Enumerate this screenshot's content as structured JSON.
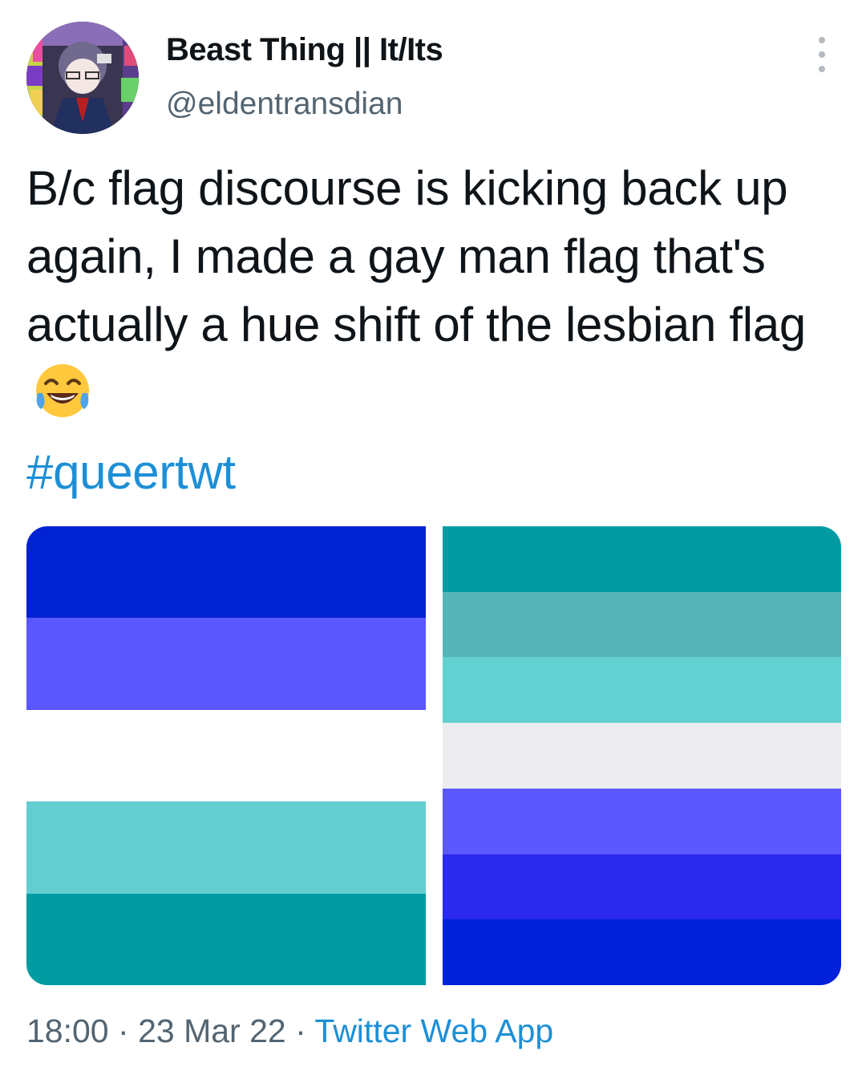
{
  "tweet": {
    "display_name": "Beast Thing || It/Its",
    "handle": "@eldentransdian",
    "text": "B/c flag discourse is kicking back up again, I made a gay man flag that's actually a hue shift of the lesbian flag",
    "emoji": "face-with-tears-of-joy",
    "hashtag": "#queertwt",
    "time": "18:00",
    "separator": "·",
    "date": "23 Mar 22",
    "source": "Twitter Web App"
  },
  "media": {
    "left_flag": {
      "stripes": [
        "#0022d1",
        "#5b57ff",
        "#ffffff",
        "#63cdd1",
        "#019ba2"
      ]
    },
    "right_flag": {
      "stripes": [
        "#019ca3",
        "#56b5b8",
        "#63d0d2",
        "#ececee",
        "#5c58ff",
        "#2a29ed",
        "#0021d9"
      ]
    }
  },
  "colors": {
    "text": "#0f1419",
    "secondary": "#536471",
    "link": "#1d8fd6"
  }
}
